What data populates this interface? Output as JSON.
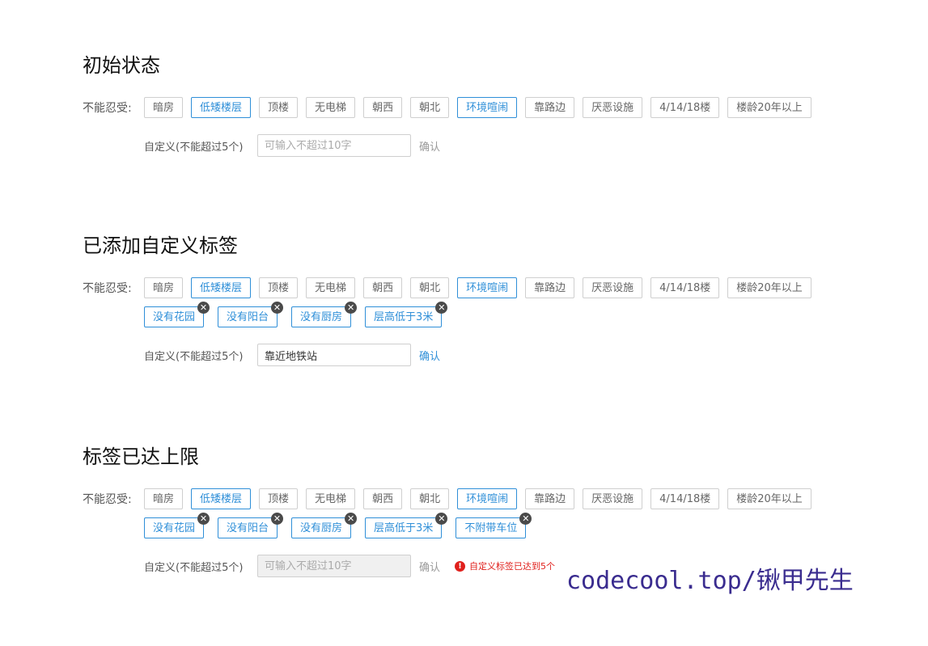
{
  "sections": [
    {
      "title": "初始状态",
      "row_label": "不能忍受:",
      "tags": [
        {
          "label": "暗房",
          "selected": false
        },
        {
          "label": "低矮楼层",
          "selected": true
        },
        {
          "label": "顶楼",
          "selected": false
        },
        {
          "label": "无电梯",
          "selected": false
        },
        {
          "label": "朝西",
          "selected": false
        },
        {
          "label": "朝北",
          "selected": false
        },
        {
          "label": "环境喧闹",
          "selected": true
        },
        {
          "label": "靠路边",
          "selected": false
        },
        {
          "label": "厌恶设施",
          "selected": false
        },
        {
          "label": "4/14/18楼",
          "selected": false
        },
        {
          "label": "楼龄20年以上",
          "selected": false
        }
      ],
      "custom_tags": [],
      "custom_label": "自定义(不能超过5个)",
      "input_value": "",
      "input_placeholder": "可输入不超过10字",
      "input_disabled": false,
      "confirm_label": "确认",
      "confirm_active": false,
      "error": ""
    },
    {
      "title": "已添加自定义标签",
      "row_label": "不能忍受:",
      "tags": [
        {
          "label": "暗房",
          "selected": false
        },
        {
          "label": "低矮楼层",
          "selected": true
        },
        {
          "label": "顶楼",
          "selected": false
        },
        {
          "label": "无电梯",
          "selected": false
        },
        {
          "label": "朝西",
          "selected": false
        },
        {
          "label": "朝北",
          "selected": false
        },
        {
          "label": "环境喧闹",
          "selected": true
        },
        {
          "label": "靠路边",
          "selected": false
        },
        {
          "label": "厌恶设施",
          "selected": false
        },
        {
          "label": "4/14/18楼",
          "selected": false
        },
        {
          "label": "楼龄20年以上",
          "selected": false
        }
      ],
      "custom_tags": [
        "没有花园",
        "没有阳台",
        "没有厨房",
        "层高低于3米"
      ],
      "custom_label": "自定义(不能超过5个)",
      "input_value": "靠近地铁站",
      "input_placeholder": "可输入不超过10字",
      "input_disabled": false,
      "confirm_label": "确认",
      "confirm_active": true,
      "error": ""
    },
    {
      "title": "标签已达上限",
      "row_label": "不能忍受:",
      "tags": [
        {
          "label": "暗房",
          "selected": false
        },
        {
          "label": "低矮楼层",
          "selected": true
        },
        {
          "label": "顶楼",
          "selected": false
        },
        {
          "label": "无电梯",
          "selected": false
        },
        {
          "label": "朝西",
          "selected": false
        },
        {
          "label": "朝北",
          "selected": false
        },
        {
          "label": "环境喧闹",
          "selected": true
        },
        {
          "label": "靠路边",
          "selected": false
        },
        {
          "label": "厌恶设施",
          "selected": false
        },
        {
          "label": "4/14/18楼",
          "selected": false
        },
        {
          "label": "楼龄20年以上",
          "selected": false
        }
      ],
      "custom_tags": [
        "没有花园",
        "没有阳台",
        "没有厨房",
        "层高低于3米",
        "不附带车位"
      ],
      "custom_label": "自定义(不能超过5个)",
      "input_value": "",
      "input_placeholder": "可输入不超过10字",
      "input_disabled": true,
      "confirm_label": "确认",
      "confirm_active": false,
      "error": "自定义标签已达到5个"
    }
  ],
  "watermark": "codecool.top/锹甲先生",
  "colors": {
    "accent": "#2f8fd8",
    "error": "#e0201c",
    "watermark": "#3a2c8f"
  }
}
